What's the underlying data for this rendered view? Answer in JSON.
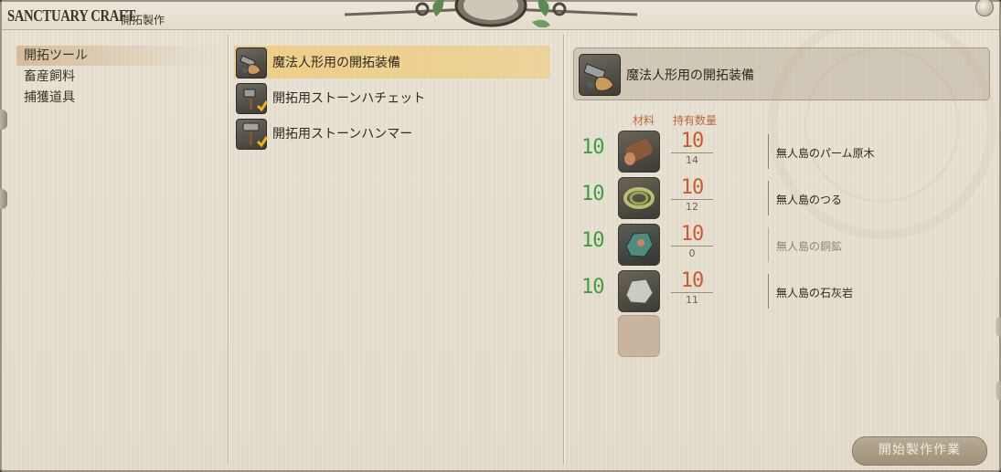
{
  "title": {
    "en": "SANCTUARY CRAFT",
    "jp": "開拓製作"
  },
  "categories": [
    {
      "label": "開拓ツール",
      "selected": true
    },
    {
      "label": "畜産飼料",
      "selected": false
    },
    {
      "label": "捕獲道具",
      "selected": false
    }
  ],
  "recipes": [
    {
      "label": "魔法人形用の開拓装備",
      "selected": true,
      "icon": "golem-gear-icon",
      "crafted": false
    },
    {
      "label": "開拓用ストーンハチェット",
      "selected": false,
      "icon": "hatchet-icon",
      "crafted": true
    },
    {
      "label": "開拓用ストーンハンマー",
      "selected": false,
      "icon": "hammer-icon",
      "crafted": true
    }
  ],
  "detail": {
    "title": "魔法人形用の開拓装備",
    "icon": "golem-gear-icon",
    "col_material": "材料",
    "col_owned": "持有数量",
    "materials": [
      {
        "required": "10",
        "owned": "10",
        "stock": "14",
        "name": "無人島のパーム原木",
        "icon": "palm-log-icon",
        "available": true
      },
      {
        "required": "10",
        "owned": "10",
        "stock": "12",
        "name": "無人島のつる",
        "icon": "vine-coil-icon",
        "available": true
      },
      {
        "required": "10",
        "owned": "10",
        "stock": "0",
        "name": "無人島の銅鉱",
        "icon": "copper-ore-icon",
        "available": false
      },
      {
        "required": "10",
        "owned": "10",
        "stock": "11",
        "name": "無人島の石灰岩",
        "icon": "limestone-icon",
        "available": true
      }
    ]
  },
  "start_button": "開始製作作業",
  "colors": {
    "required_qty": "#3f9d3f",
    "owned_qty": "#cc5a2e",
    "selected_highlight": "#f0c86e"
  }
}
